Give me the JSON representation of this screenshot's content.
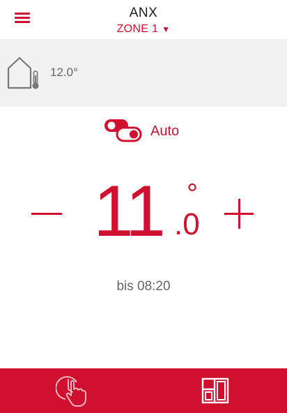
{
  "header": {
    "title": "ANX",
    "zone_label": "ZONE 1",
    "zone_caret": "▼"
  },
  "outdoor": {
    "temperature": "12.0°"
  },
  "mode": {
    "label": "Auto"
  },
  "setpoint": {
    "integer": "11",
    "decimal": ".0",
    "degree": "°"
  },
  "schedule": {
    "until_text": "bis 08:20"
  },
  "theme": {
    "accent": "#d0102f",
    "outdoor_bg": "#f1f1f1",
    "text_gray": "#666666"
  },
  "icons": {
    "menu": "hamburger-menu-icon",
    "outdoor": "house-thermometer-icon",
    "mode": "toggle-switch-icon",
    "nav_schedule": "clock-hand-icon",
    "nav_zones": "room-layout-icon"
  }
}
